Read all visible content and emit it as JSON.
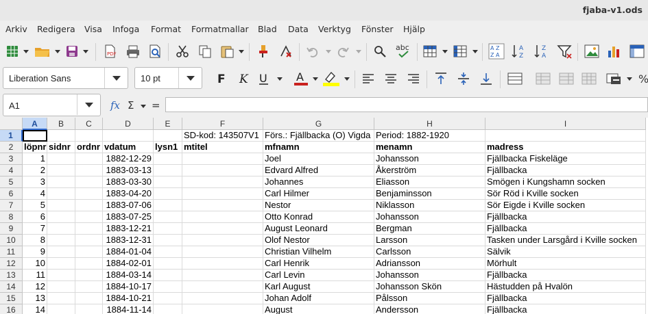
{
  "window": {
    "title": "fjaba-v1.ods"
  },
  "menu": [
    "Arkiv",
    "Redigera",
    "Visa",
    "Infoga",
    "Format",
    "Formatmallar",
    "Blad",
    "Data",
    "Verktyg",
    "Fönster",
    "Hjälp"
  ],
  "toolbar": {
    "font_name": "Liberation Sans",
    "font_size": "10 pt",
    "font_color": "#c9211e",
    "highlight_color": "#ffff00"
  },
  "formula_bar": {
    "name_box": "A1",
    "formula": ""
  },
  "columns": [
    "A",
    "B",
    "C",
    "D",
    "E",
    "F",
    "G",
    "H",
    "I"
  ],
  "rows": [
    {
      "n": "1",
      "cells": [
        "",
        "",
        "",
        "",
        "",
        "SD-kod: 143507V1",
        "Förs.: Fjällbacka (O) Vigda",
        "Period: 1882-1920",
        ""
      ]
    },
    {
      "n": "2",
      "cells": [
        "löpnr",
        "sidnr",
        "ordnr",
        "vdatum",
        "lysn1",
        "mtitel",
        "mfnamn",
        "menamn",
        "madress"
      ]
    },
    {
      "n": "3",
      "cells": [
        "1",
        "",
        "",
        "1882-12-29",
        "",
        "",
        "Joel",
        "Johansson",
        "Fjällbacka Fiskeläge"
      ]
    },
    {
      "n": "4",
      "cells": [
        "2",
        "",
        "",
        "1883-03-13",
        "",
        "",
        "Edvard Alfred",
        "Åkerström",
        "Fjällbacka"
      ]
    },
    {
      "n": "5",
      "cells": [
        "3",
        "",
        "",
        "1883-03-30",
        "",
        "",
        "Johannes",
        "Eliasson",
        "Smögen i Kungshamn socken"
      ]
    },
    {
      "n": "6",
      "cells": [
        "4",
        "",
        "",
        "1883-04-20",
        "",
        "",
        "Carl Hilmer",
        "Benjaminsson",
        "Sör Röd i Kville socken"
      ]
    },
    {
      "n": "7",
      "cells": [
        "5",
        "",
        "",
        "1883-07-06",
        "",
        "",
        "Nestor",
        "Niklasson",
        "Sör Eigde i Kville socken"
      ]
    },
    {
      "n": "8",
      "cells": [
        "6",
        "",
        "",
        "1883-07-25",
        "",
        "",
        "Otto Konrad",
        "Johansson",
        "Fjällbacka"
      ]
    },
    {
      "n": "9",
      "cells": [
        "7",
        "",
        "",
        "1883-12-21",
        "",
        "",
        "August Leonard",
        "Bergman",
        "Fjällbacka"
      ]
    },
    {
      "n": "10",
      "cells": [
        "8",
        "",
        "",
        "1883-12-31",
        "",
        "",
        "Olof Nestor",
        "Larsson",
        "Tasken under Larsgård i Kville socken"
      ]
    },
    {
      "n": "11",
      "cells": [
        "9",
        "",
        "",
        "1884-01-04",
        "",
        "",
        "Christian Vilhelm",
        "Carlsson",
        "Sälvik"
      ]
    },
    {
      "n": "12",
      "cells": [
        "10",
        "",
        "",
        "1884-02-01",
        "",
        "",
        "Carl Henrik",
        "Adriansson",
        "Mörhult"
      ]
    },
    {
      "n": "13",
      "cells": [
        "11",
        "",
        "",
        "1884-03-14",
        "",
        "",
        "Carl Levin",
        "Johansson",
        "Fjällbacka"
      ]
    },
    {
      "n": "14",
      "cells": [
        "12",
        "",
        "",
        "1884-10-17",
        "",
        "",
        "Karl August",
        "Johansson Skön",
        "Hästudden på Hvalön"
      ]
    },
    {
      "n": "15",
      "cells": [
        "13",
        "",
        "",
        "1884-10-21",
        "",
        "",
        "Johan Adolf",
        "Pålsson",
        "Fjällbacka"
      ]
    },
    {
      "n": "16",
      "cells": [
        "14",
        "",
        "",
        "1884-11-14",
        "",
        "",
        "August",
        "Andersson",
        "Fjällbacka"
      ]
    }
  ]
}
